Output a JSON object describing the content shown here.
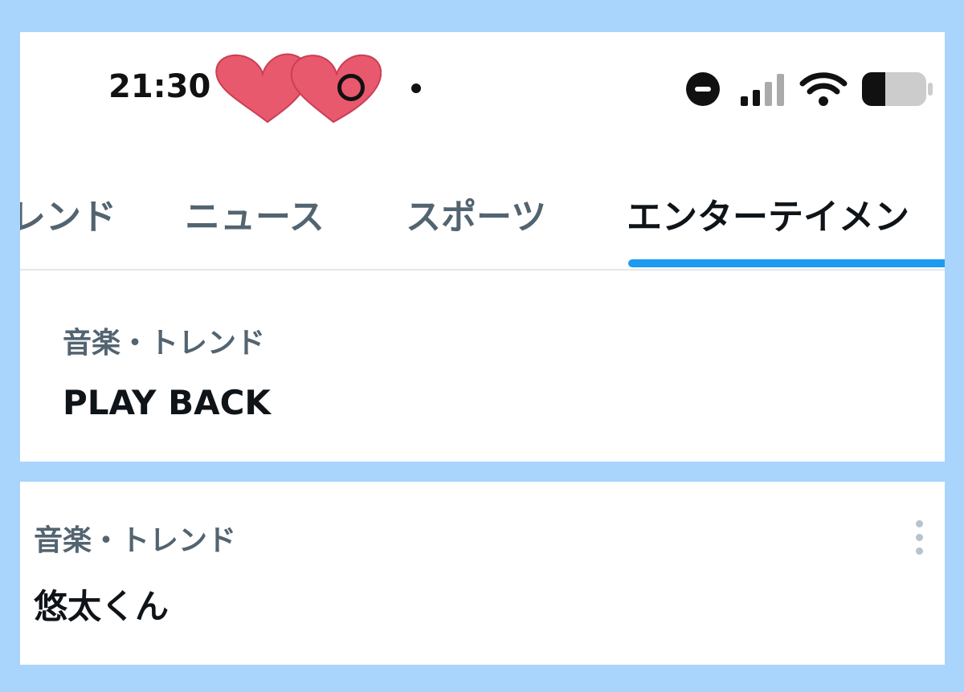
{
  "status_bar": {
    "time": "21:30",
    "icons": [
      "heart-sticker-icon",
      "ring-icon",
      "dot-indicator-icon",
      "do-not-disturb-icon",
      "cellular-signal-icon",
      "wifi-icon",
      "battery-icon"
    ],
    "battery_level": 0.35
  },
  "tabs": [
    {
      "label": "レンド",
      "active": false
    },
    {
      "label": "ニュース",
      "active": false
    },
    {
      "label": "スポーツ",
      "active": false
    },
    {
      "label": "エンターテイメン",
      "active": true
    }
  ],
  "trends": [
    {
      "category": "音楽・トレンド",
      "name": "PLAY BACK"
    },
    {
      "category": "音楽・トレンド",
      "name": "悠太くん"
    }
  ],
  "colors": {
    "background": "#a9d4fb",
    "accent": "#1d9bf0",
    "secondary_text": "#536471",
    "primary_text": "#0f1419",
    "heart": "#e9596e"
  }
}
